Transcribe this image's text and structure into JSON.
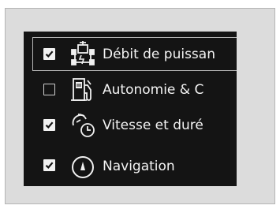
{
  "menu": {
    "items": [
      {
        "label": "Débit de puissan",
        "checked": true,
        "icon": "power-flow-icon",
        "focused": true
      },
      {
        "label": "Autonomie & C",
        "checked": false,
        "icon": "fuel-pump-icon",
        "focused": false
      },
      {
        "label": "Vitesse et duré",
        "checked": true,
        "icon": "speed-time-icon",
        "focused": false
      },
      {
        "label": "Navigation",
        "checked": true,
        "icon": "compass-icon",
        "focused": false
      }
    ]
  },
  "colors": {
    "screen_bg": "#141414",
    "text": "#f4f4f4",
    "focus_border": "#b9b9b9"
  }
}
